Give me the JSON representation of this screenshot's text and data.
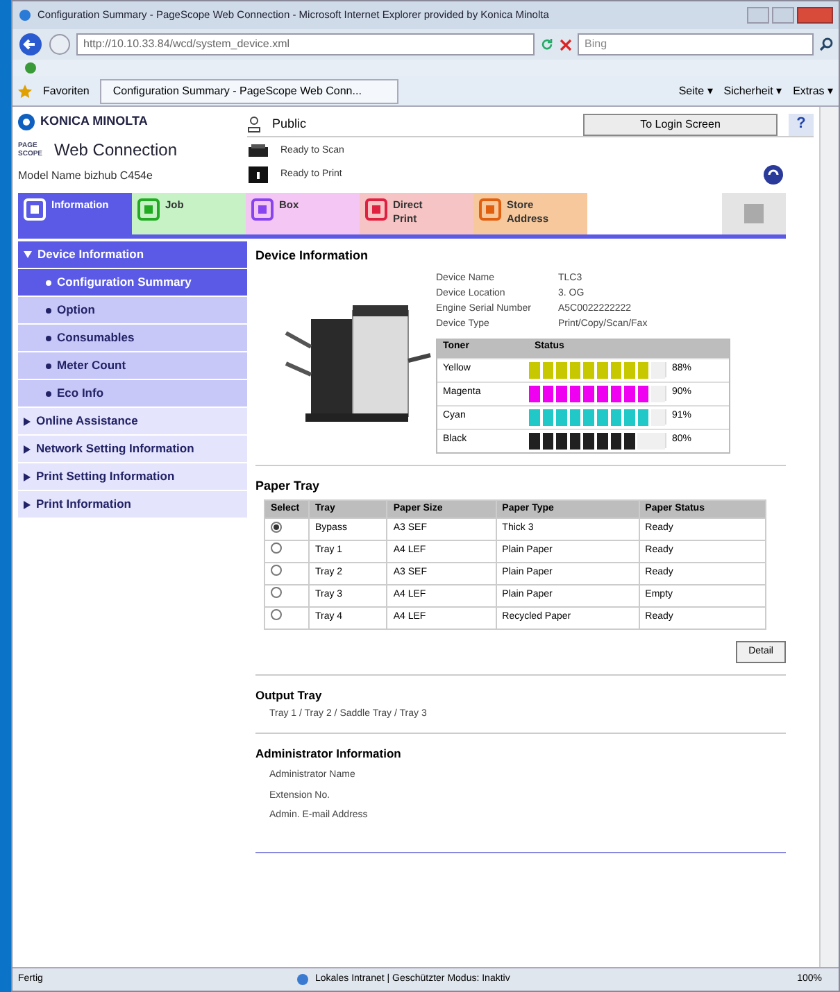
{
  "browser": {
    "title": "Configuration Summary - PageScope Web Connection - Microsoft Internet Explorer provided by Konica Minolta",
    "address": "http://10.10.33.84/wcd/system_device.xml",
    "search_placeholder": "Bing",
    "favorites": "Favoriten",
    "tab_title": "Configuration Summary - PageScope Web Conn...",
    "command_menus": [
      "Seite ▾",
      "Sicherheit ▾",
      "Extras ▾"
    ]
  },
  "header": {
    "brand": "KONICA MINOLTA",
    "product_small": "PAGE SCOPE",
    "product": "Web Connection",
    "model": "Model Name bizhub C454e",
    "user": "Public",
    "login_button": "To Login Screen",
    "help": "?",
    "statuses": [
      {
        "kind": "scan",
        "text": "Ready to Scan"
      },
      {
        "kind": "print",
        "text": "Ready to Print"
      }
    ]
  },
  "tabs": [
    {
      "label": "Information",
      "selected": true,
      "color": "#5a5ae6"
    },
    {
      "label": "Job",
      "selected": false,
      "color": "#c6f2c6"
    },
    {
      "label": "Box",
      "selected": false,
      "color": "#f4c6f4"
    },
    {
      "label": "Direct Print",
      "selected": false,
      "color": "#f6c4c4"
    },
    {
      "label": "Store Address",
      "selected": false,
      "color": "#f6c89c"
    }
  ],
  "sidebar": [
    {
      "label": "Device Information",
      "expanded": true,
      "selected": false,
      "children": [
        {
          "label": "Configuration Summary",
          "selected": true
        },
        {
          "label": "Option",
          "selected": false
        },
        {
          "label": "Consumables",
          "selected": false
        },
        {
          "label": "Meter Count",
          "selected": false
        },
        {
          "label": "Eco Info",
          "selected": false
        }
      ]
    },
    {
      "label": "Online Assistance",
      "expanded": false,
      "selected": false
    },
    {
      "label": "Network Setting Information",
      "expanded": false,
      "selected": false
    },
    {
      "label": "Print Setting Information",
      "expanded": false,
      "selected": false
    },
    {
      "label": "Print Information",
      "expanded": false,
      "selected": false
    }
  ],
  "device_info": {
    "title": "Device Information",
    "fields": [
      {
        "label": "Device Name",
        "value": "TLC3"
      },
      {
        "label": "Device Location",
        "value": "3. OG"
      },
      {
        "label": "Engine Serial Number",
        "value": "A5C0022222222"
      },
      {
        "label": "Device Type",
        "value": "Print/Copy/Scan/Fax"
      }
    ],
    "toner": {
      "columns": [
        "Toner",
        "Status"
      ],
      "rows": [
        {
          "name": "Yellow",
          "level": 0.9,
          "reading": "88%",
          "color": "#c8c800"
        },
        {
          "name": "Magenta",
          "level": 0.9,
          "reading": "90%",
          "color": "#f000f0"
        },
        {
          "name": "Cyan",
          "level": 0.9,
          "reading": "91%",
          "color": "#20c8c8"
        },
        {
          "name": "Black",
          "level": 0.8,
          "reading": "80%",
          "color": "#202020"
        }
      ]
    }
  },
  "paper_tray": {
    "title": "Paper Tray",
    "columns": [
      "Select",
      "Tray",
      "Paper Size",
      "Paper Type",
      "Paper Status"
    ],
    "rows": [
      {
        "selected": true,
        "cells": [
          "",
          "Bypass",
          "A3 SEF",
          "Thick 3",
          "Ready"
        ]
      },
      {
        "selected": false,
        "cells": [
          "",
          "Tray 1",
          "A4 LEF",
          "Plain Paper",
          "Ready"
        ]
      },
      {
        "selected": false,
        "cells": [
          "",
          "Tray 2",
          "A3 SEF",
          "Plain Paper",
          "Ready"
        ]
      },
      {
        "selected": false,
        "cells": [
          "",
          "Tray 3",
          "A4 LEF",
          "Plain Paper",
          "Empty"
        ]
      },
      {
        "selected": false,
        "cells": [
          "",
          "Tray 4",
          "A4 LEF",
          "Recycled Paper",
          "Ready"
        ]
      }
    ],
    "button": "Detail"
  },
  "output_tray": {
    "title": "Output Tray",
    "value": "Tray 1 / Tray 2 / Saddle Tray / Tray 3"
  },
  "admin": {
    "title": "Administrator Information",
    "fields": [
      "Administrator Name",
      "Extension No.",
      "Admin. E-mail Address"
    ]
  },
  "status_bar": {
    "status": "Fertig",
    "zone": "Lokales Intranet | Geschützter Modus: Inaktiv",
    "zoom": "100%"
  }
}
